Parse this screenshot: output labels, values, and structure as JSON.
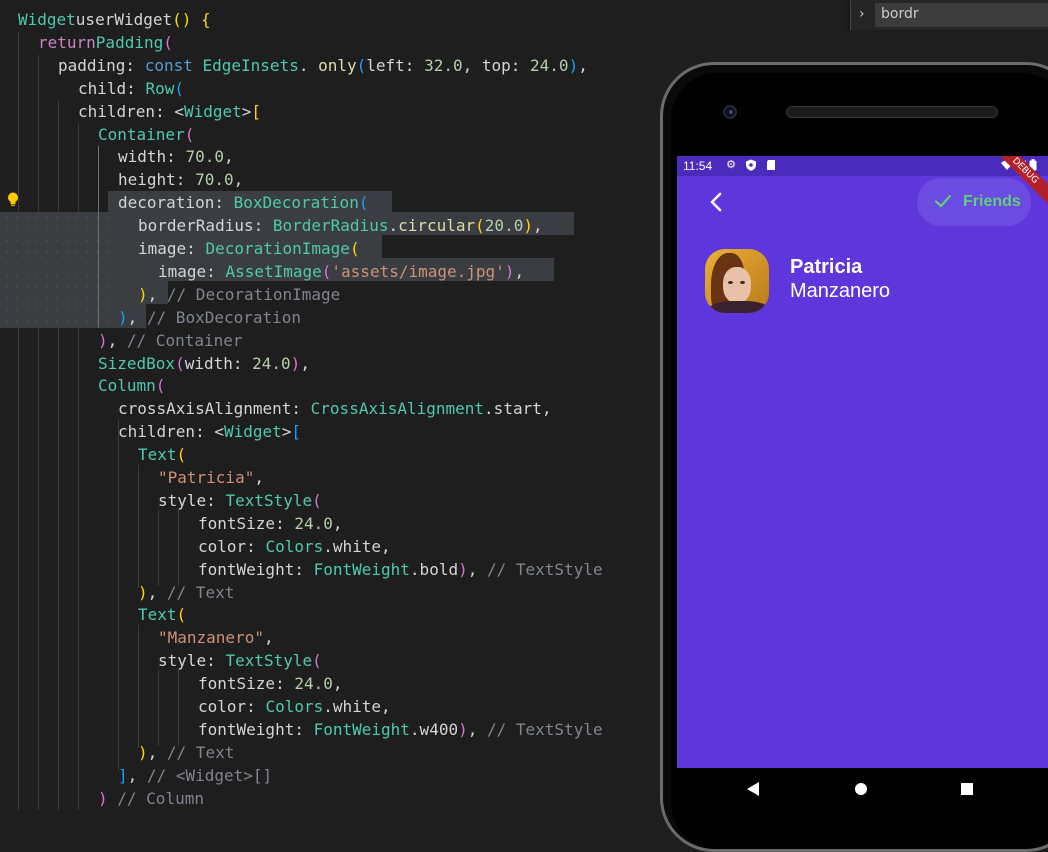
{
  "editor": {
    "lines": [
      [
        [
          "t-cls",
          "Widget"
        ],
        [
          "",
          "userWidget"
        ],
        [
          "t-br1",
          "() {"
        ]
      ],
      [
        [
          "t-kw",
          "return"
        ],
        [
          "t-cls",
          "Padding"
        ],
        [
          "t-br2",
          "("
        ]
      ],
      [
        [
          "",
          "padding: "
        ],
        [
          "t-kb",
          "const "
        ],
        [
          "t-cls",
          "EdgeInsets"
        ],
        [
          "",
          ". "
        ],
        [
          "t-fn",
          "only"
        ],
        [
          "t-br3",
          "("
        ],
        [
          "",
          "left: "
        ],
        [
          "t-num",
          "32.0"
        ],
        [
          "",
          ", top: "
        ],
        [
          "t-num",
          "24.0"
        ],
        [
          "t-br3",
          ")"
        ],
        [
          "",
          ","
        ]
      ],
      [
        [
          "",
          "child: "
        ],
        [
          "t-cls",
          "Row"
        ],
        [
          "t-br3",
          "("
        ]
      ],
      [
        [
          "",
          "children: <"
        ],
        [
          "t-cls",
          "Widget"
        ],
        [
          "",
          ">"
        ],
        [
          "t-br1",
          "["
        ]
      ],
      [
        [
          "t-cls",
          "Container"
        ],
        [
          "t-br2",
          "("
        ]
      ],
      [
        [
          "",
          "width: "
        ],
        [
          "t-num",
          "70.0"
        ],
        [
          "",
          ","
        ]
      ],
      [
        [
          "",
          "height: "
        ],
        [
          "t-num",
          "70.0"
        ],
        [
          "",
          ","
        ]
      ],
      [
        [
          "",
          "decoration: "
        ],
        [
          "t-cls",
          "BoxDecoration"
        ],
        [
          "t-br3",
          "("
        ]
      ],
      [
        [
          "",
          "borderRadius: "
        ],
        [
          "t-cls",
          "BorderRadius"
        ],
        [
          "",
          "."
        ],
        [
          "t-fn",
          "circular"
        ],
        [
          "t-br1",
          "("
        ],
        [
          "t-num",
          "20.0"
        ],
        [
          "t-br1",
          ")"
        ],
        [
          "",
          ","
        ]
      ],
      [
        [
          "",
          "image: "
        ],
        [
          "t-cls",
          "DecorationImage"
        ],
        [
          "t-br1",
          "("
        ]
      ],
      [
        [
          "",
          "image: "
        ],
        [
          "t-cls",
          "AssetImage"
        ],
        [
          "t-br2",
          "("
        ],
        [
          "t-str",
          "'assets/image.jpg'"
        ],
        [
          "t-br2",
          ")"
        ],
        [
          "",
          ","
        ]
      ],
      [
        [
          "t-br1",
          ")"
        ],
        [
          "",
          ", "
        ],
        [
          "t-cmt",
          "// DecorationImage"
        ]
      ],
      [
        [
          "t-br3",
          ")"
        ],
        [
          "",
          ", "
        ],
        [
          "t-cmt",
          "// BoxDecoration"
        ]
      ],
      [
        [
          "t-br2",
          ")"
        ],
        [
          "",
          ", "
        ],
        [
          "t-cmt",
          "// Container"
        ]
      ],
      [
        [
          "t-cls",
          "SizedBox"
        ],
        [
          "t-br2",
          "("
        ],
        [
          "",
          "width: "
        ],
        [
          "t-num",
          "24.0"
        ],
        [
          "t-br2",
          ")"
        ],
        [
          "",
          ","
        ]
      ],
      [
        [
          "t-cls",
          "Column"
        ],
        [
          "t-br2",
          "("
        ]
      ],
      [
        [
          "",
          "crossAxisAlignment: "
        ],
        [
          "t-cls",
          "CrossAxisAlignment"
        ],
        [
          "",
          ".start,"
        ]
      ],
      [
        [
          "",
          "children: <"
        ],
        [
          "t-cls",
          "Widget"
        ],
        [
          "",
          ">"
        ],
        [
          "t-br3",
          "["
        ]
      ],
      [
        [
          "t-cls",
          "Text"
        ],
        [
          "t-br1",
          "("
        ]
      ],
      [
        [
          "t-str",
          "\"Patricia\""
        ],
        [
          "",
          ","
        ]
      ],
      [
        [
          "",
          "style: "
        ],
        [
          "t-cls",
          "TextStyle"
        ],
        [
          "t-br2",
          "("
        ]
      ],
      [
        [
          "",
          "fontSize: "
        ],
        [
          "t-num",
          "24.0"
        ],
        [
          "",
          ","
        ]
      ],
      [
        [
          "",
          "color: "
        ],
        [
          "t-cls",
          "Colors"
        ],
        [
          "",
          ".white,"
        ]
      ],
      [
        [
          "",
          "fontWeight: "
        ],
        [
          "t-cls",
          "FontWeight"
        ],
        [
          "",
          ".bold"
        ],
        [
          "t-br2",
          ")"
        ],
        [
          "",
          ", "
        ],
        [
          "t-cmt",
          "// TextStyle"
        ]
      ],
      [
        [
          "t-br1",
          ")"
        ],
        [
          "",
          ", "
        ],
        [
          "t-cmt",
          "// Text"
        ]
      ],
      [
        [
          "t-cls",
          "Text"
        ],
        [
          "t-br1",
          "("
        ]
      ],
      [
        [
          "t-str",
          "\"Manzanero\""
        ],
        [
          "",
          ","
        ]
      ],
      [
        [
          "",
          "style: "
        ],
        [
          "t-cls",
          "TextStyle"
        ],
        [
          "t-br2",
          "("
        ]
      ],
      [
        [
          "",
          "fontSize: "
        ],
        [
          "t-num",
          "24.0"
        ],
        [
          "",
          ","
        ]
      ],
      [
        [
          "",
          "color: "
        ],
        [
          "t-cls",
          "Colors"
        ],
        [
          "",
          ".white,"
        ]
      ],
      [
        [
          "",
          "fontWeight: "
        ],
        [
          "t-cls",
          "FontWeight"
        ],
        [
          "",
          ".w400"
        ],
        [
          "t-br2",
          ")"
        ],
        [
          "",
          ", "
        ],
        [
          "t-cmt",
          "// TextStyle"
        ]
      ],
      [
        [
          "t-br1",
          ")"
        ],
        [
          "",
          ", "
        ],
        [
          "t-cmt",
          "// Text"
        ]
      ],
      [
        [
          "t-br3",
          "]"
        ],
        [
          "",
          ", "
        ],
        [
          "t-cmt",
          "// <Widget>[]"
        ]
      ],
      [
        [
          "t-br2",
          ")"
        ],
        [
          "t-cmt",
          " // Column"
        ]
      ]
    ]
  },
  "find": {
    "chevron": "›",
    "query": "bordr"
  },
  "device": {
    "status": {
      "time": "11:54"
    },
    "debug_banner": "DEBUG",
    "app": {
      "friends_label": "Friends",
      "first_name": "Patricia",
      "last_name": "Manzanero"
    }
  },
  "colors": {
    "app_background": "#5e37dc",
    "status_bar": "#4a2bbb",
    "friends_chip": "#6c4ce0",
    "friends_accent": "#5fcf80"
  }
}
